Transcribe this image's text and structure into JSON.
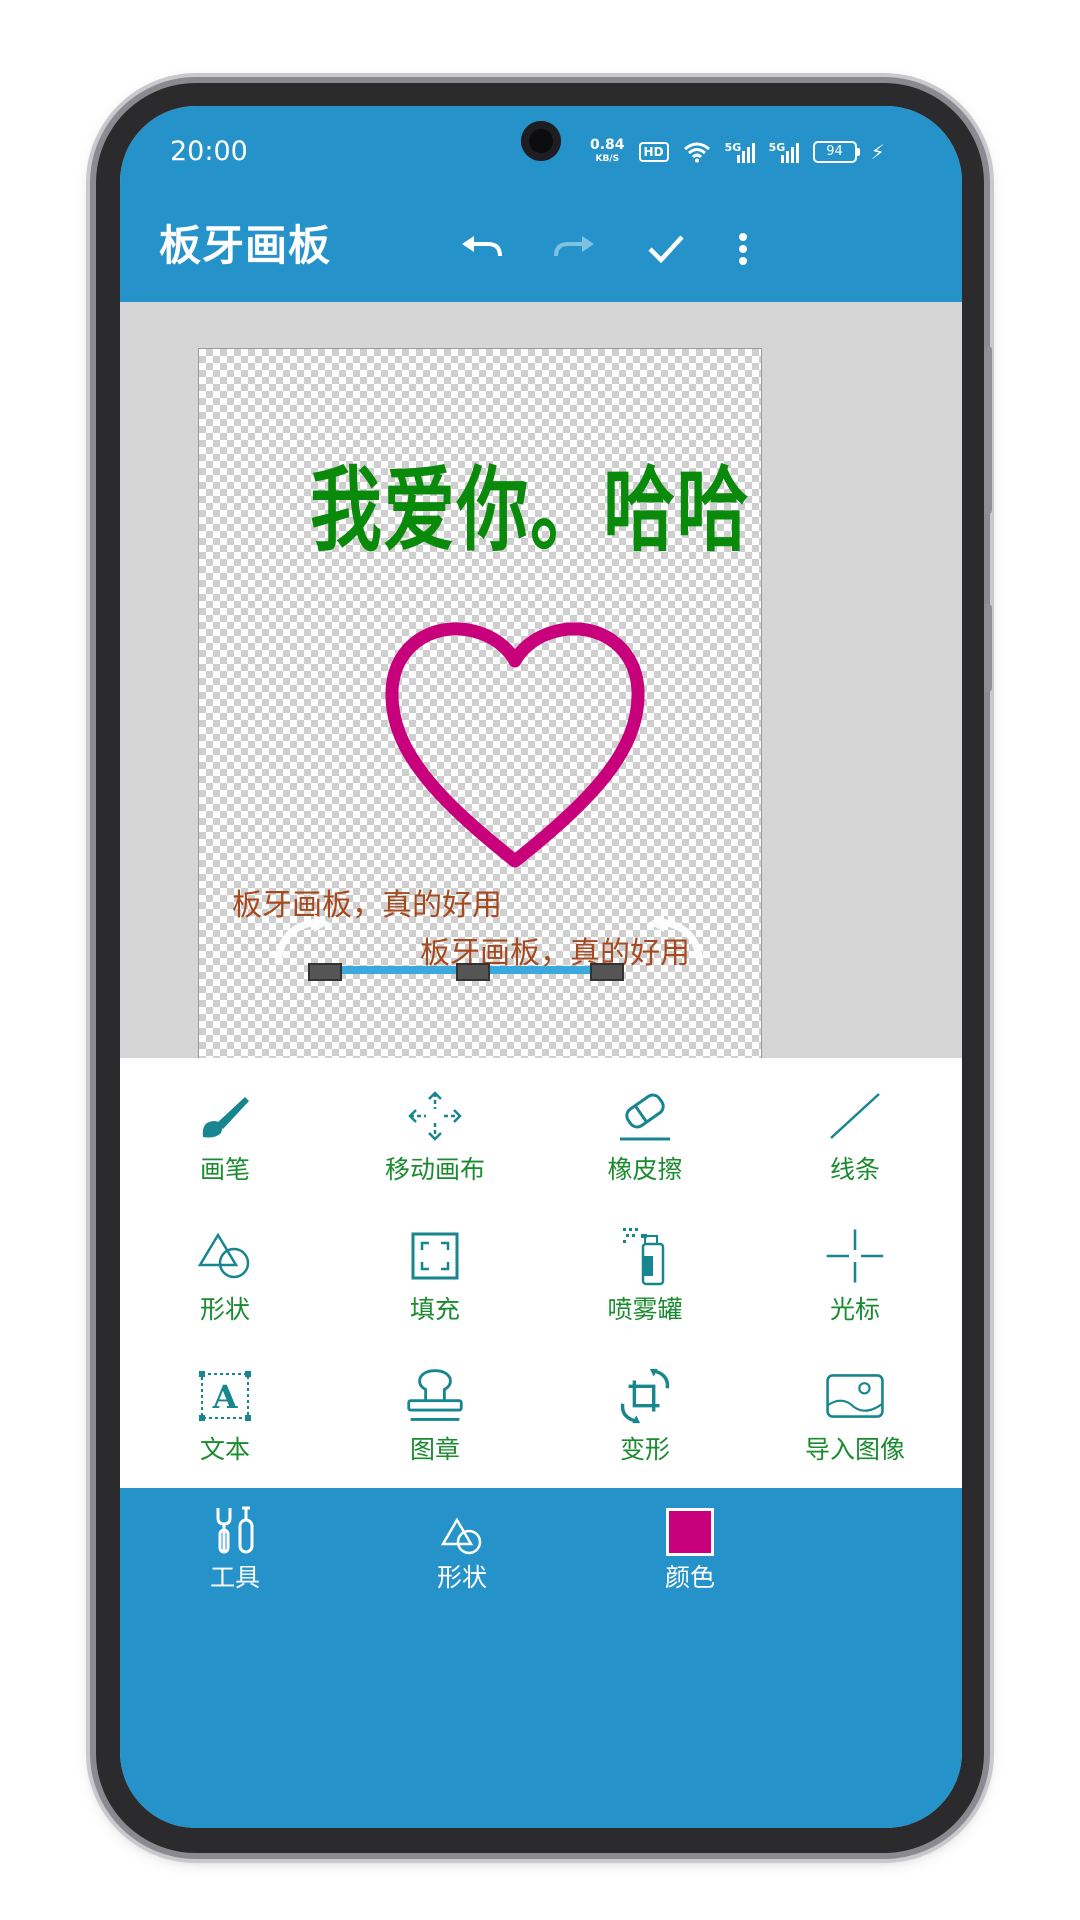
{
  "status_bar": {
    "time": "20:00",
    "net_speed": "0.84",
    "net_unit": "KB/S",
    "hd": "HD",
    "sim1": "5G",
    "sim2": "5G",
    "battery": "94"
  },
  "app_bar": {
    "title": "板牙画板",
    "icons": [
      "undo-icon",
      "redo-icon",
      "check-icon",
      "more-vert-icon"
    ]
  },
  "canvas": {
    "text_main": "我爱你。哈哈",
    "text_main_color": "#0a8a0a",
    "heart_color": "#c8007c",
    "label_a": "板牙画板，真的好用",
    "label_b": "板牙画板，真的好用",
    "label_color": "#a7491f"
  },
  "tools": [
    {
      "label": "画笔",
      "icon": "brush-icon"
    },
    {
      "label": "移动画布",
      "icon": "move-icon"
    },
    {
      "label": "橡皮擦",
      "icon": "eraser-icon"
    },
    {
      "label": "线条",
      "icon": "line-icon"
    },
    {
      "label": "形状",
      "icon": "shapes-icon"
    },
    {
      "label": "填充",
      "icon": "fill-icon"
    },
    {
      "label": "喷雾罐",
      "icon": "spray-icon"
    },
    {
      "label": "光标",
      "icon": "crosshair-icon"
    },
    {
      "label": "文本",
      "icon": "text-icon"
    },
    {
      "label": "图章",
      "icon": "stamp-icon"
    },
    {
      "label": "变形",
      "icon": "transform-icon"
    },
    {
      "label": "导入图像",
      "icon": "import-image-icon"
    }
  ],
  "bottom_nav": {
    "tools": "工具",
    "shapes": "形状",
    "color": "颜色",
    "current_color": "#c8007c"
  },
  "theme": {
    "primary": "#2593c9",
    "accent_teal": "#17868f",
    "label_green": "#1a8b2f"
  }
}
